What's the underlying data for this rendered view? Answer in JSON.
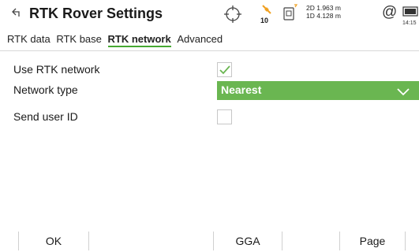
{
  "header": {
    "title": "RTK Rover Settings",
    "satellites": "10",
    "precision_2d": "2D 1.963 m",
    "precision_1d": "1D 4.128 m",
    "at_symbol": "@",
    "time": "14:15"
  },
  "tabs": [
    {
      "label": "RTK data",
      "active": false
    },
    {
      "label": "RTK base",
      "active": false
    },
    {
      "label": "RTK network",
      "active": true
    },
    {
      "label": "Advanced",
      "active": false
    }
  ],
  "fields": {
    "use_rtk_network": {
      "label": "Use RTK network",
      "checked": true
    },
    "network_type": {
      "label": "Network type",
      "value": "Nearest"
    },
    "send_user_id": {
      "label": "Send user ID",
      "checked": false
    }
  },
  "footer": {
    "ok": "OK",
    "gga": "GGA",
    "page": "Page"
  },
  "colors": {
    "accent": "#6ab651",
    "tab_underline": "#46a832",
    "satellite": "#f0a020"
  }
}
